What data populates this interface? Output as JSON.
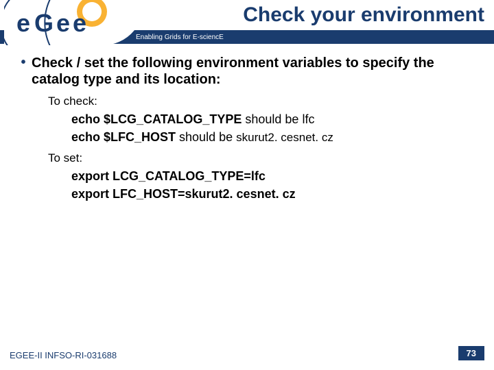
{
  "header": {
    "title": "Check your environment",
    "tagline": "Enabling Grids for E-sciencE",
    "logo_text": "egee"
  },
  "content": {
    "bullet": "Check / set the following environment variables to specify the catalog type and its location:",
    "to_check_label": "To check:",
    "check_line1_cmd": "echo $LCG_CATALOG_TYPE",
    "check_line1_note": " should be lfc",
    "check_line2_cmd": "echo $LFC_HOST",
    "check_line2_note": "  should be ",
    "check_line2_val": "skurut2. cesnet. cz",
    "to_set_label": "To set:",
    "set_line1": "export LCG_CATALOG_TYPE=lfc",
    "set_line2": "export LFC_HOST=skurut2. cesnet. cz"
  },
  "footer": {
    "left": "EGEE-II INFSO-RI-031688",
    "page": "73"
  }
}
